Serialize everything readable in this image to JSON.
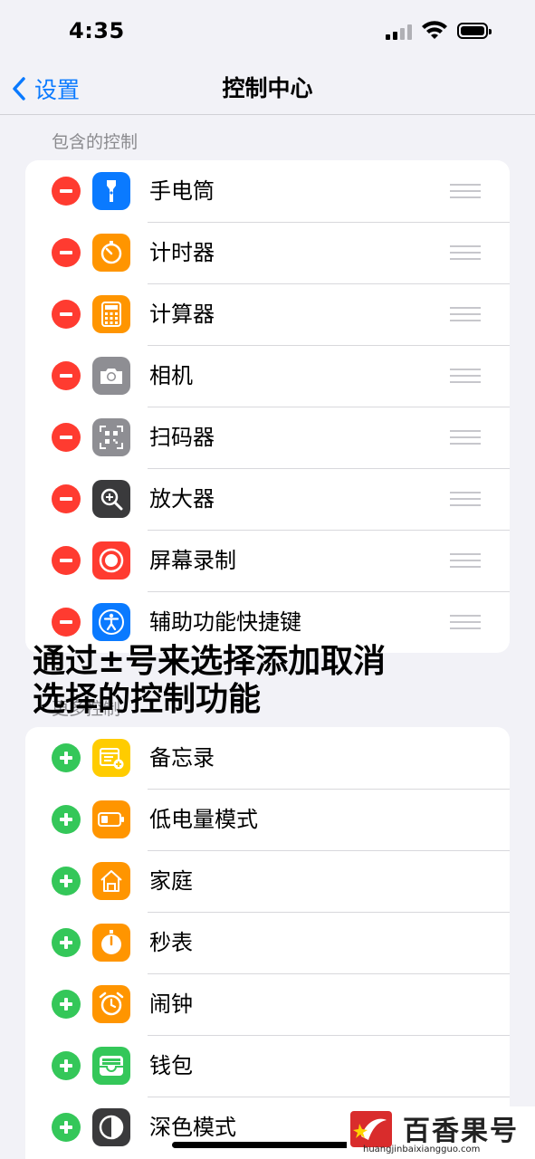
{
  "status": {
    "time": "4:35"
  },
  "nav": {
    "back_label": "设置",
    "title": "控制中心"
  },
  "included": {
    "header": "包含的控制",
    "items": [
      {
        "label": "手电筒",
        "icon": "flashlight-icon",
        "color": "#0a7aff"
      },
      {
        "label": "计时器",
        "icon": "timer-icon",
        "color": "#ff9500"
      },
      {
        "label": "计算器",
        "icon": "calculator-icon",
        "color": "#ff9500"
      },
      {
        "label": "相机",
        "icon": "camera-icon",
        "color": "#8e8e93"
      },
      {
        "label": "扫码器",
        "icon": "qr-scanner-icon",
        "color": "#8e8e93"
      },
      {
        "label": "放大器",
        "icon": "magnifier-icon",
        "color": "#3a3a3c"
      },
      {
        "label": "屏幕录制",
        "icon": "screen-record-icon",
        "color": "#ff3b30"
      },
      {
        "label": "辅助功能快捷键",
        "icon": "accessibility-icon",
        "color": "#0a7aff"
      }
    ]
  },
  "more": {
    "header": "更多控制",
    "items": [
      {
        "label": "备忘录",
        "icon": "notes-icon",
        "color": "#ffcc00"
      },
      {
        "label": "低电量模式",
        "icon": "low-power-icon",
        "color": "#ff9500"
      },
      {
        "label": "家庭",
        "icon": "home-icon",
        "color": "#ff9500"
      },
      {
        "label": "秒表",
        "icon": "stopwatch-icon",
        "color": "#ff9500"
      },
      {
        "label": "闹钟",
        "icon": "alarm-icon",
        "color": "#ff9500"
      },
      {
        "label": "钱包",
        "icon": "wallet-icon",
        "color": "#34c759"
      },
      {
        "label": "深色模式",
        "icon": "dark-mode-icon",
        "color": "#3a3a3c"
      }
    ]
  },
  "caption": {
    "line1": "通过±号来选择添加取消",
    "line2": "选择的控制功能"
  },
  "watermark": {
    "text": "百香果号",
    "url": "huangjinbaixiangguo.com"
  }
}
